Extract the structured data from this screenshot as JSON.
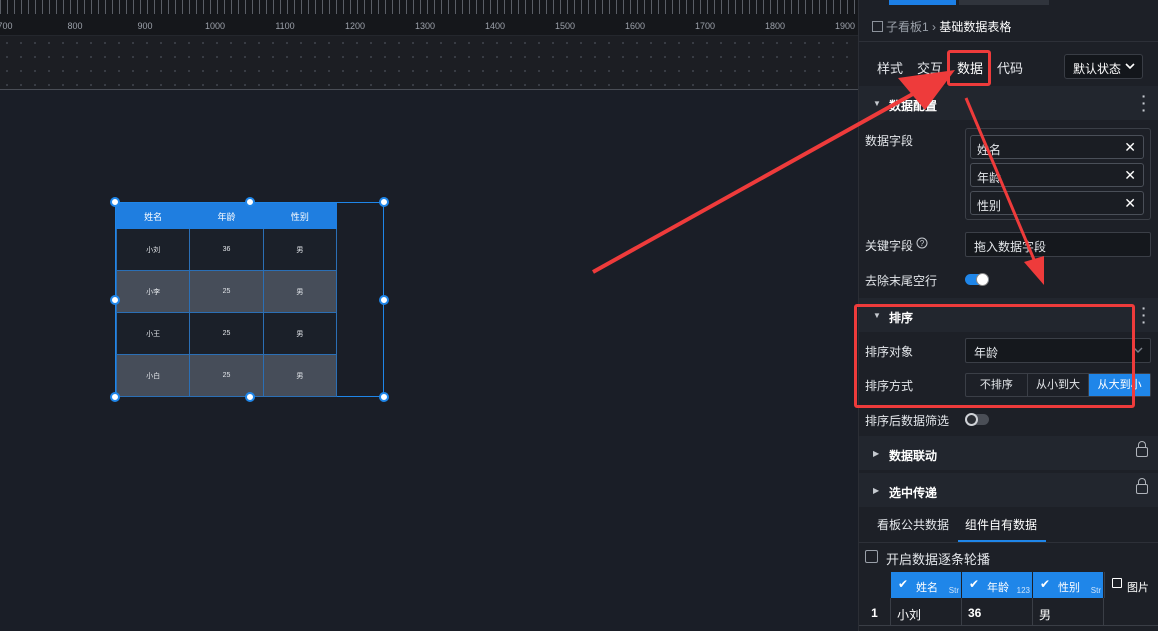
{
  "ruler": {
    "labels": [
      "700",
      "800",
      "900",
      "1000",
      "1100",
      "1200",
      "1300",
      "1400",
      "1500",
      "1600",
      "1700",
      "1800",
      "1900"
    ]
  },
  "table_widget": {
    "headers": [
      "姓名",
      "年龄",
      "性别"
    ],
    "rows": [
      [
        "小刘",
        "36",
        "男"
      ],
      [
        "小李",
        "25",
        "男"
      ],
      [
        "小王",
        "25",
        "男"
      ],
      [
        "小白",
        "25",
        "男"
      ]
    ]
  },
  "panel": {
    "breadcrumb": {
      "parent": "子看板1",
      "sep": "›",
      "current": "基础数据表格"
    },
    "tabs": [
      "样式",
      "交互",
      "数据",
      "代码"
    ],
    "state_select": "默认状态",
    "data_section": {
      "title": "数据配置",
      "fields_label": "数据字段",
      "fields": [
        "姓名",
        "年龄",
        "性别"
      ],
      "key_label": "关键字段",
      "key_placeholder": "拖入数据字段",
      "trim_label": "去除末尾空行"
    },
    "sort_section": {
      "title": "排序",
      "target_label": "排序对象",
      "target_value": "年龄",
      "mode_label": "排序方式",
      "modes": [
        "不排序",
        "从小到大",
        "从大到小"
      ],
      "selected_mode": "从大到小",
      "filter_label": "排序后数据筛选"
    },
    "linkage_title": "数据联动",
    "pass_title": "选中传递",
    "bottom_tabs": [
      "看板公共数据",
      "组件自有数据"
    ],
    "carousel_label": "开启数据逐条轮播",
    "grid": {
      "columns": [
        {
          "name": "姓名",
          "type": "Str"
        },
        {
          "name": "年龄",
          "type": "123"
        },
        {
          "name": "性别",
          "type": "Str"
        },
        {
          "name": "图片",
          "type": ""
        }
      ],
      "rows": [
        {
          "index": "1",
          "cells": [
            "小刘",
            "36",
            "男",
            ""
          ]
        }
      ]
    }
  },
  "colors": {
    "accent": "#1f86e9",
    "highlight": "#ee3b3b"
  }
}
